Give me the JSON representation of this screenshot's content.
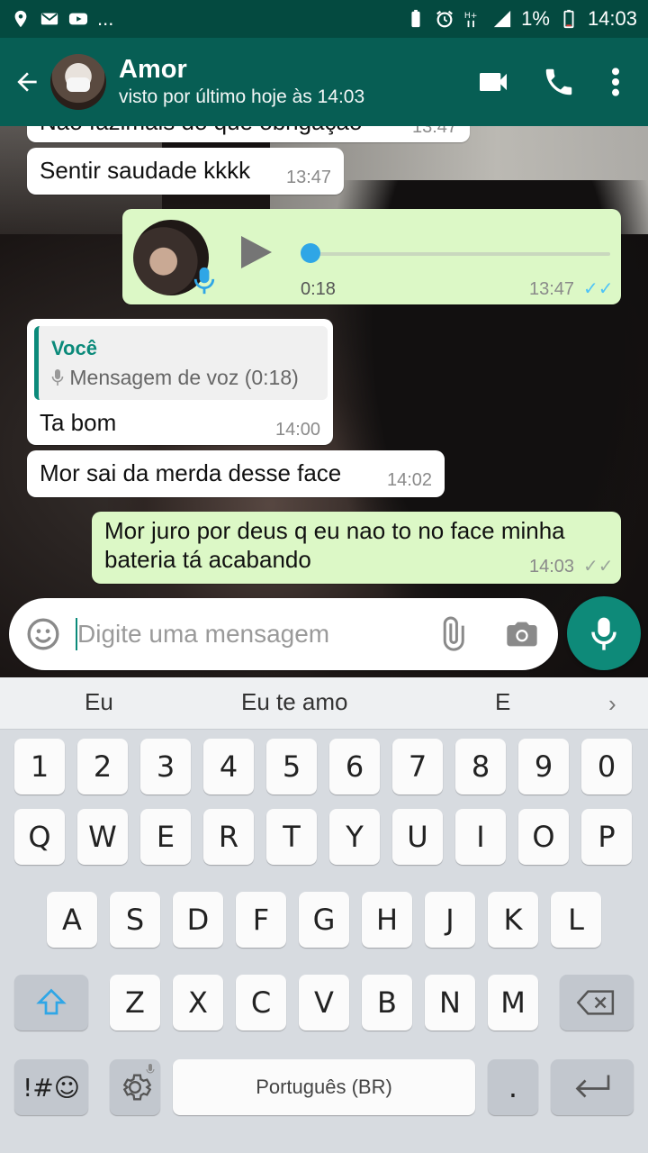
{
  "status_bar": {
    "left_icons": [
      "location-icon",
      "mail-icon",
      "youtube-icon",
      "more-dots"
    ],
    "left_dots": "...",
    "battery_percent": "1%",
    "time": "14:03"
  },
  "header": {
    "contact_name": "Amor",
    "last_seen": "visto por último hoje às 14:03"
  },
  "messages": [
    {
      "dir": "in",
      "text": "Não fazimais do que obrigação",
      "time": "13:47"
    },
    {
      "dir": "in",
      "text": "Sentir saudade kkkk",
      "time": "13:47"
    },
    {
      "dir": "out",
      "type": "voice",
      "duration": "0:18",
      "progress": 0.0,
      "time": "13:47",
      "ticks": "✓✓"
    },
    {
      "dir": "in",
      "quote_author": "Você",
      "quote_text": "Mensagem de voz (0:18)",
      "text": "Ta bom",
      "time": "14:00"
    },
    {
      "dir": "in",
      "text": "Mor sai da merda desse face",
      "time": "14:02"
    },
    {
      "dir": "out",
      "text_line1": "Mor juro por deus q eu nao to no face minha",
      "text_line2": "bateria tá acabando",
      "time": "14:03",
      "ticks": "✓✓"
    }
  ],
  "composer": {
    "placeholder": "Digite uma mensagem"
  },
  "keyboard": {
    "suggestions": [
      "Eu",
      "Eu te amo",
      "E"
    ],
    "suggest_arrow": "›",
    "row_numbers": [
      "1",
      "2",
      "3",
      "4",
      "5",
      "6",
      "7",
      "8",
      "9",
      "0"
    ],
    "row_q": [
      "Q",
      "W",
      "E",
      "R",
      "T",
      "Y",
      "U",
      "I",
      "O",
      "P"
    ],
    "row_a": [
      "A",
      "S",
      "D",
      "F",
      "G",
      "H",
      "J",
      "K",
      "L"
    ],
    "row_z": [
      "Z",
      "X",
      "C",
      "V",
      "B",
      "N",
      "M"
    ],
    "symbols_label": "!#☺",
    "space_label": "Português (BR)",
    "period_label": "."
  },
  "colors": {
    "header": "#075e54",
    "status_bar": "#044a40",
    "outgoing_bubble": "#dcf8c6",
    "incoming_bubble": "#ffffff",
    "read_ticks": "#4fc3f7",
    "fab": "#0e8a79"
  }
}
